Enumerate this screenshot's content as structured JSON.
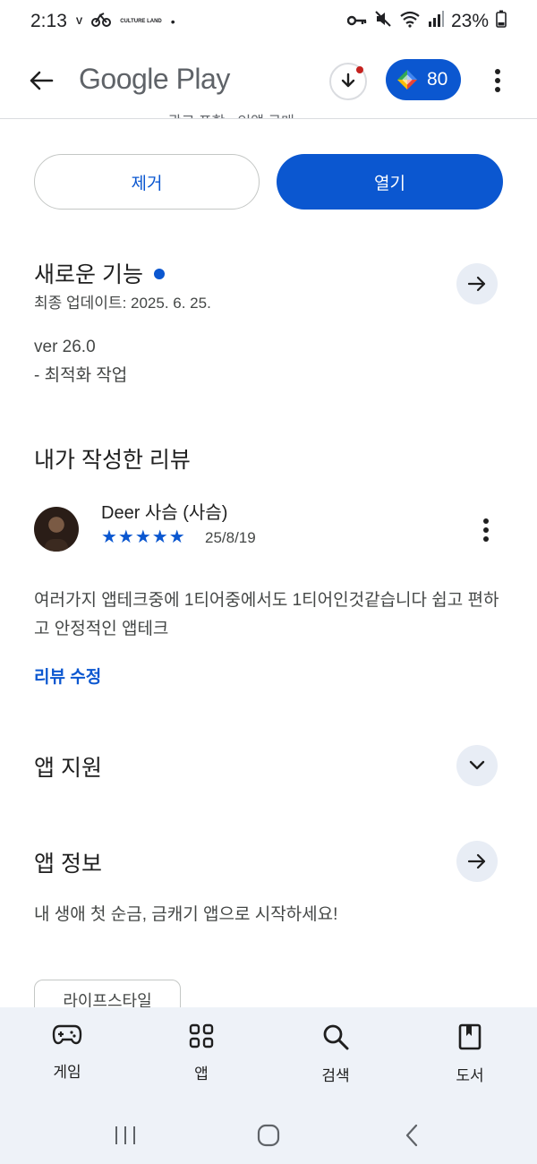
{
  "status_bar": {
    "time": "2:13",
    "app_badge_1": "V",
    "app_badge_2": "CULTURE LAND",
    "dot": "•",
    "battery": "23%"
  },
  "appbar": {
    "title": "Google Play",
    "points": "80"
  },
  "clipped_meta": "광고 포함 · 인앱 구매",
  "actions": {
    "remove_label": "제거",
    "open_label": "열기"
  },
  "whats_new": {
    "title": "새로운 기능",
    "updated": "최종 업데이트: 2025. 6. 25.",
    "version": "ver 26.0",
    "notes": "- 최적화 작업"
  },
  "my_review": {
    "title": "내가 작성한 리뷰",
    "reviewer": "Deer 사슴 (사슴)",
    "stars": "★★★★★",
    "rating": 5,
    "date": "25/8/19",
    "text": "여러가지 앱테크중에 1티어중에서도 1티어인것같습니다 쉽고 편하고 안정적인 앱테크",
    "edit_label": "리뷰 수정"
  },
  "app_support": {
    "title": "앱 지원"
  },
  "app_info": {
    "title": "앱 정보",
    "description": "내 생애 첫 순금, 금캐기 앱으로 시작하세요!"
  },
  "category_chip": "라이프스타일",
  "bottom_nav": {
    "items": [
      {
        "label": "게임",
        "icon": "gamepad-icon"
      },
      {
        "label": "앱",
        "icon": "apps-grid-icon"
      },
      {
        "label": "검색",
        "icon": "search-icon"
      },
      {
        "label": "도서",
        "icon": "book-icon"
      }
    ]
  },
  "colors": {
    "accent": "#0b57d0",
    "nav_background": "#eef2f8",
    "arrow_button_bg": "#e8edf5",
    "notification_dot": "#c5221f"
  }
}
